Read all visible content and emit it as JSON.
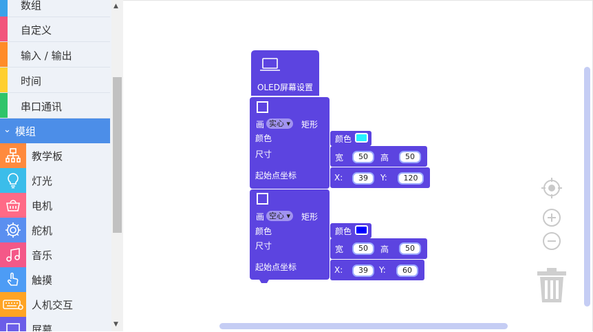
{
  "sidebar": {
    "categories": [
      {
        "label": "数组",
        "color": "#3aa2e9"
      },
      {
        "label": "自定义",
        "color": "#f2557c"
      },
      {
        "label": "输入 / 输出",
        "color": "#ff8c28"
      },
      {
        "label": "时间",
        "color": "#ffcf2e"
      },
      {
        "label": "串口通讯",
        "color": "#2fc46a"
      }
    ],
    "module_header": {
      "label": "模组",
      "color": "#4c8ee8"
    },
    "modules": [
      {
        "label": "教学板",
        "icon": "board-icon",
        "color": "#ff8a3d"
      },
      {
        "label": "灯光",
        "icon": "bulb-icon",
        "color": "#3bbdea"
      },
      {
        "label": "电机",
        "icon": "motor-icon",
        "color": "#ff6a86"
      },
      {
        "label": "舵机",
        "icon": "servo-gear-icon",
        "color": "#5a8ff0"
      },
      {
        "label": "音乐",
        "icon": "music-note-icon",
        "color": "#f45888"
      },
      {
        "label": "触摸",
        "icon": "touch-hand-icon",
        "color": "#4d9cf5"
      },
      {
        "label": "人机交互",
        "icon": "keyboard-icon",
        "color": "#ffa424"
      },
      {
        "label": "屏幕",
        "icon": "screen-icon",
        "color": "#6b5de8"
      }
    ]
  },
  "blocks": {
    "color": "#5c44e0",
    "hat": {
      "label": "OLED屏幕设置",
      "icon": "laptop-icon"
    },
    "rect1": {
      "draw": "画",
      "fill_mode": "实心",
      "shape": "矩形",
      "color_label": "颜色",
      "color_block_label": "颜色",
      "color_value": "#27f2ff",
      "size_label": "尺寸",
      "w_label": "宽",
      "w": "50",
      "h_label": "高",
      "h": "50",
      "origin_label": "起始点坐标",
      "x_label": "X:",
      "x": "39",
      "y_label": "Y:",
      "y": "120"
    },
    "rect2": {
      "draw": "画",
      "fill_mode": "空心",
      "shape": "矩形",
      "color_label": "颜色",
      "color_block_label": "颜色",
      "color_value": "#0000ff",
      "size_label": "尺寸",
      "w_label": "宽",
      "w": "50",
      "h_label": "高",
      "h": "50",
      "origin_label": "起始点坐标",
      "x_label": "X:",
      "x": "39",
      "y_label": "Y:",
      "y": "60"
    }
  },
  "controls": [
    "recenter-icon",
    "zoom-in-icon",
    "zoom-out-icon",
    "trash-icon"
  ]
}
